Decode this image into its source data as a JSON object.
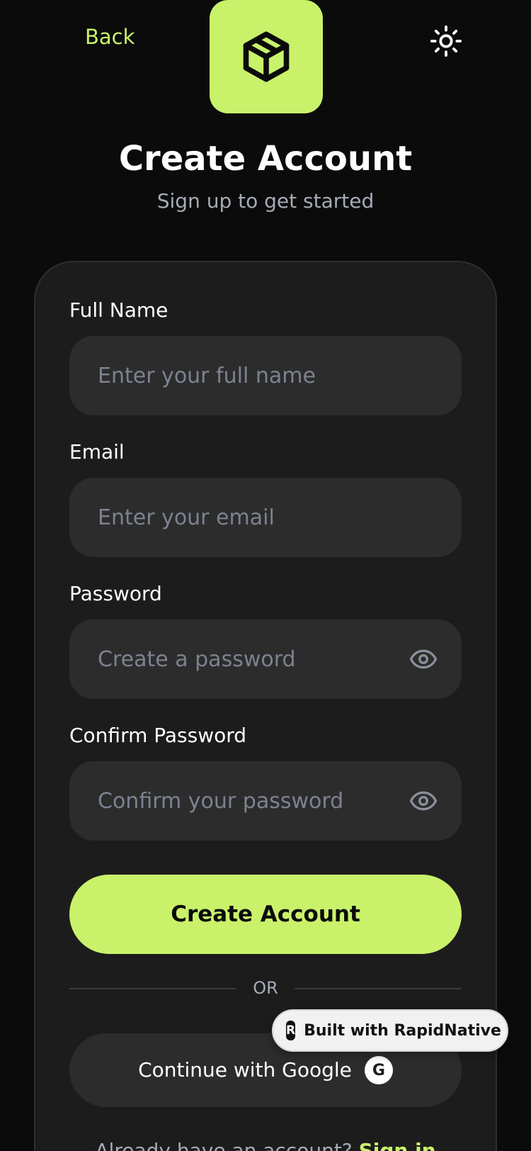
{
  "header": {
    "back_label": "Back",
    "theme_icon": "sun-icon",
    "logo_icon": "package-box-icon",
    "title": "Create Account",
    "subtitle": "Sign up to get started"
  },
  "form": {
    "full_name": {
      "label": "Full Name",
      "placeholder": "Enter your full name",
      "value": ""
    },
    "email": {
      "label": "Email",
      "placeholder": "Enter your email",
      "value": ""
    },
    "password": {
      "label": "Password",
      "placeholder": "Create a password",
      "value": "",
      "toggle_icon": "eye-icon"
    },
    "confirm_password": {
      "label": "Confirm Password",
      "placeholder": "Confirm your password",
      "value": "",
      "toggle_icon": "eye-icon"
    },
    "submit_label": "Create Account"
  },
  "divider": {
    "label": "OR"
  },
  "social": {
    "google_label": "Continue with Google",
    "google_glyph": "G"
  },
  "badge": {
    "logo_glyph": "R",
    "label": "Built with RapidNative"
  },
  "footer": {
    "prompt": "Already have an account?",
    "link_label": "Sign in"
  },
  "colors": {
    "background": "#0b0b0b",
    "card": "#1c1c1c",
    "input": "#2c2c2c",
    "accent": "#c9f26a",
    "muted_text": "#a5abb6",
    "placeholder": "#7c8290"
  }
}
